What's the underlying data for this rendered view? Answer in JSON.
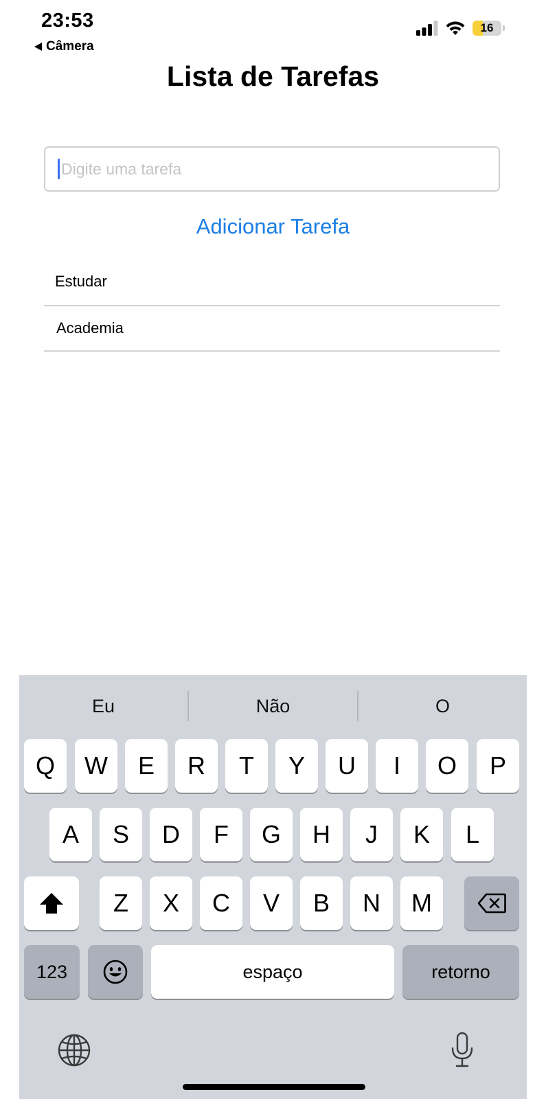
{
  "status_bar": {
    "time": "23:53",
    "back_label": "Câmera",
    "battery_level": "16",
    "battery_fraction": 0.16,
    "battery_fill_color": "#f7cf3b",
    "icons": [
      "signal-icon",
      "wifi-icon",
      "battery-icon"
    ]
  },
  "header": {
    "title": "Lista de Tarefas"
  },
  "task_form": {
    "placeholder": "Digite uma tarefa",
    "value": "",
    "add_button_label": "Adicionar Tarefa",
    "accent_color": "#1c7fe3"
  },
  "tasks": [
    {
      "label": "Estudar"
    },
    {
      "label": "Academia"
    }
  ],
  "keyboard": {
    "suggestions": [
      "Eu",
      "Não",
      "O"
    ],
    "row1": [
      "Q",
      "W",
      "E",
      "R",
      "T",
      "Y",
      "U",
      "I",
      "O",
      "P"
    ],
    "row2": [
      "A",
      "S",
      "D",
      "F",
      "G",
      "H",
      "J",
      "K",
      "L"
    ],
    "row3": [
      "Z",
      "X",
      "C",
      "V",
      "B",
      "N",
      "M"
    ],
    "numbers_label": "123",
    "space_label": "espaço",
    "return_label": "retorno",
    "icons": [
      "shift-icon",
      "backspace-icon",
      "emoji-icon",
      "globe-icon",
      "microphone-icon"
    ]
  }
}
